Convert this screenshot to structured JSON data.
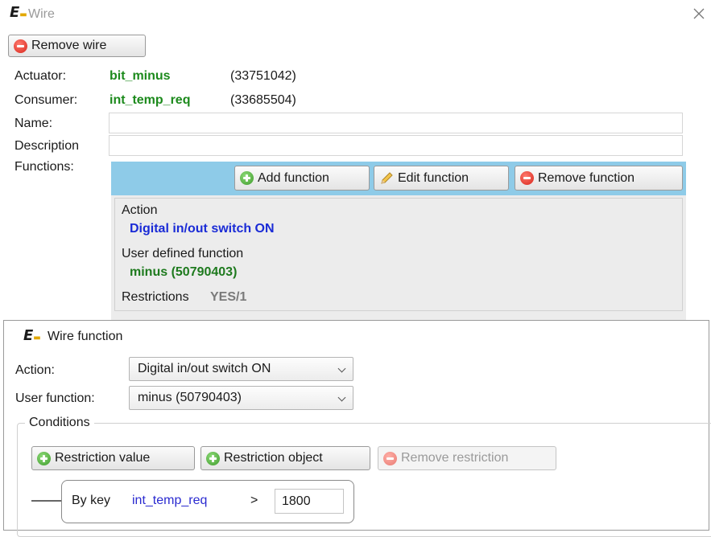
{
  "wire_window": {
    "title": "Wire",
    "remove_wire_label": "Remove wire",
    "actuator_label": "Actuator:",
    "actuator_name": "bit_minus",
    "actuator_id": "(33751042)",
    "consumer_label": "Consumer:",
    "consumer_name": "int_temp_req",
    "consumer_id": "(33685504)",
    "name_label": "Name:",
    "name_value": "",
    "description_label": "Description",
    "description_value": "",
    "functions_label": "Functions:",
    "add_function_label": "Add function",
    "edit_function_label": "Edit function",
    "remove_function_label": "Remove function",
    "function_item": {
      "action_label": "Action",
      "action_value": "Digital in/out switch ON",
      "user_function_label": "User defined function",
      "user_function_value": "minus (50790403)",
      "restrictions_label": "Restrictions",
      "restrictions_value": "YES/1"
    }
  },
  "wire_function_window": {
    "title": "Wire function",
    "action_label": "Action:",
    "action_value": "Digital in/out switch ON",
    "user_function_label": "User function:",
    "user_function_value": "minus (50790403)",
    "conditions_label": "Conditions",
    "restriction_value_label": "Restriction value",
    "restriction_object_label": "Restriction object",
    "remove_restriction_label": "Remove restriction",
    "condition": {
      "by_key_label": "By key",
      "key": "int_temp_req",
      "operator": ">",
      "value": "1800"
    }
  },
  "icons": {
    "logo": "app-logo-icon",
    "close": "close-icon",
    "remove": "remove-circle-icon",
    "add": "add-circle-icon",
    "edit": "pencil-icon",
    "dropdown": "chevron-down-icon"
  },
  "colors": {
    "accent_panel": "#8ecbe8",
    "green_text": "#1c8a1c",
    "blue_text": "#1a2bd6",
    "key_link": "#2a2ad0"
  }
}
